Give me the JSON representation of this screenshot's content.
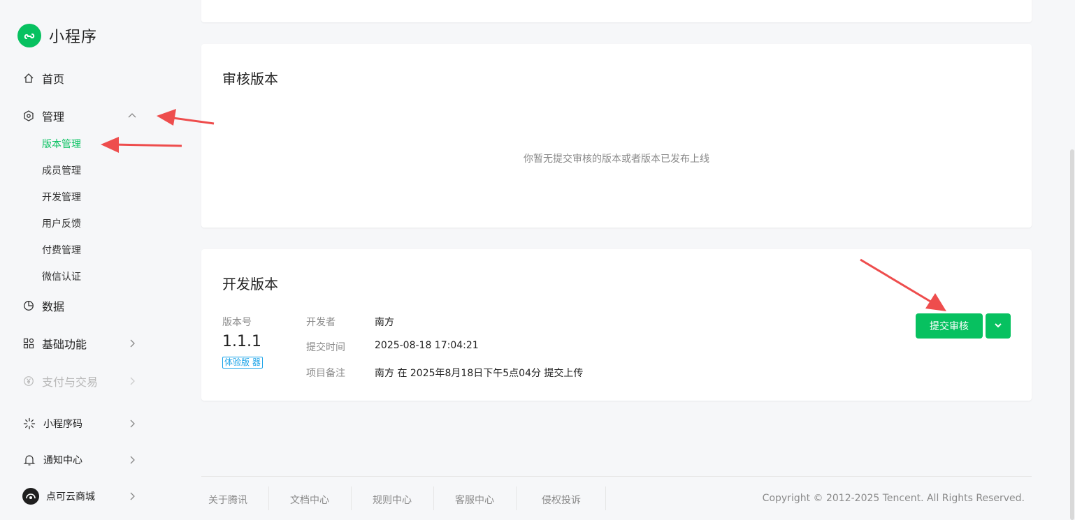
{
  "brand": {
    "title": "小程序"
  },
  "nav": {
    "home": "首页",
    "manage": "管理",
    "manage_sub": [
      "版本管理",
      "成员管理",
      "开发管理",
      "用户反馈",
      "付费管理",
      "微信认证"
    ],
    "data": "数据",
    "basic": "基础功能",
    "pay": "支付与交易",
    "qrcode": "小程序码",
    "notify": "通知中心",
    "account": "点可云商城"
  },
  "review_card": {
    "title": "审核版本",
    "empty": "你暂无提交审核的版本或者版本已发布上线"
  },
  "dev_card": {
    "title": "开发版本",
    "version_label": "版本号",
    "version": "1.1.1",
    "version_tag": "体验版 器",
    "developer_label": "开发者",
    "developer": "南方",
    "submit_time_label": "提交时间",
    "submit_time": "2025-08-18 17:04:21",
    "remark_label": "项目备注",
    "remark": "南方 在 2025年8月18日下午5点04分 提交上传",
    "submit_button": "提交审核"
  },
  "footer": {
    "links": [
      "关于腾讯",
      "文档中心",
      "规则中心",
      "客服中心",
      "侵权投诉"
    ],
    "copyright": "Copyright © 2012-2025 Tencent. All Rights Reserved."
  },
  "colors": {
    "accent": "#07c160",
    "annotation": "#ee4d4d",
    "tag": "#1aa3e8"
  }
}
